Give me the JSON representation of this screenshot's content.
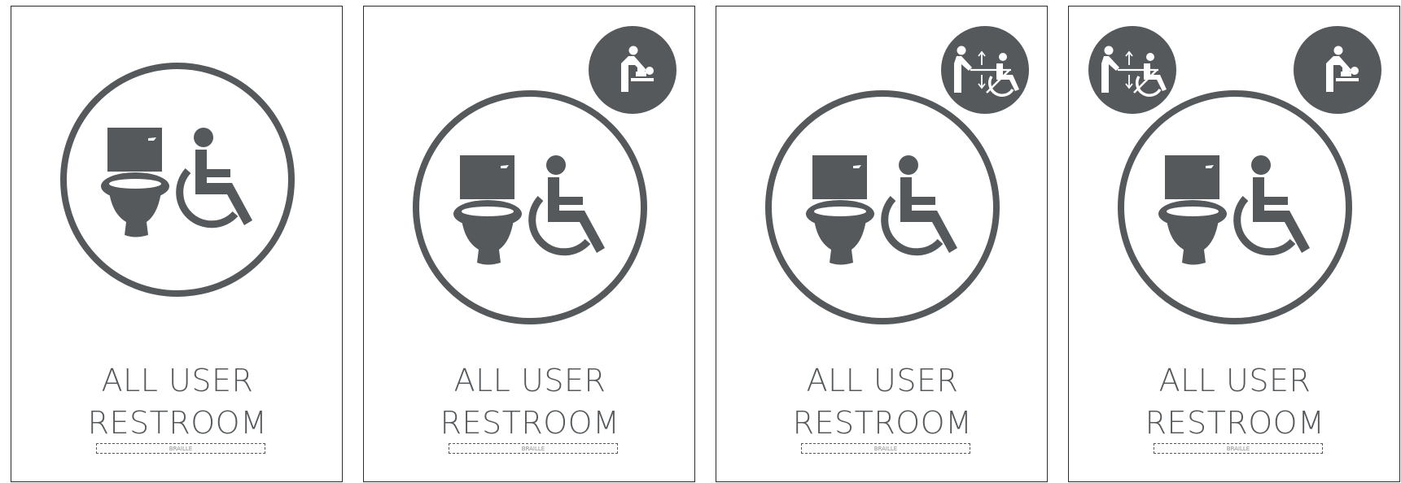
{
  "colors": {
    "icon": "#55595c",
    "border": "#2b2b2b",
    "background": "#ffffff"
  },
  "signs": [
    {
      "line1": "ALL USER",
      "line2": "RESTROOM",
      "braille_label": "BRAILLE",
      "badges": []
    },
    {
      "line1": "ALL USER",
      "line2": "RESTROOM",
      "braille_label": "BRAILLE",
      "badges": [
        "baby-changing-icon"
      ]
    },
    {
      "line1": "ALL USER",
      "line2": "RESTROOM",
      "braille_label": "BRAILLE",
      "badges": [
        "adult-changing-table-icon"
      ]
    },
    {
      "line1": "ALL USER",
      "line2": "RESTROOM",
      "braille_label": "BRAILLE",
      "badges": [
        "adult-changing-table-icon",
        "baby-changing-icon"
      ]
    }
  ]
}
